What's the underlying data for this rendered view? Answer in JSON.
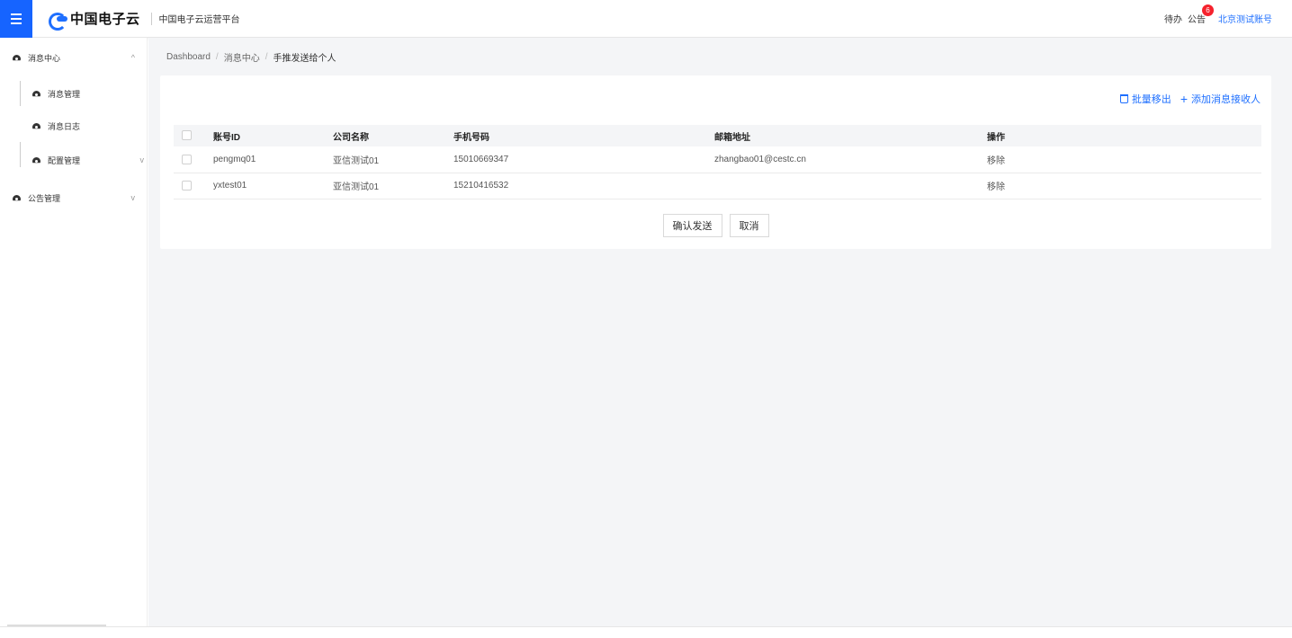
{
  "header": {
    "logo_text": "中国电子云",
    "platform_name": "中国电子云运营平台",
    "todo_label": "待办",
    "notice_label": "公告",
    "notice_badge": "6",
    "account_label": "北京测试账号"
  },
  "sidebar": {
    "items": [
      {
        "label": "消息中心",
        "chevron": "^"
      },
      {
        "label": "消息管理"
      },
      {
        "label": "消息日志"
      },
      {
        "label": "配置管理",
        "chevron": "v"
      },
      {
        "label": "公告管理",
        "chevron": "v"
      }
    ]
  },
  "breadcrumb": {
    "items": [
      "Dashboard",
      "消息中心",
      "手推发送给个人"
    ],
    "separator": "/"
  },
  "actions": {
    "batch_remove_label": "批量移出",
    "add_receiver_label": "添加消息接收人"
  },
  "table": {
    "headers": [
      "账号ID",
      "公司名称",
      "手机号码",
      "邮箱地址",
      "操作"
    ],
    "rows": [
      {
        "account_id": "pengmq01",
        "company": "亚信测试01",
        "phone": "15010669347",
        "email": "zhangbao01@cestc.cn",
        "action": "移除"
      },
      {
        "account_id": "yxtest01",
        "company": "亚信测试01",
        "phone": "15210416532",
        "email": "",
        "action": "移除"
      }
    ]
  },
  "buttons": {
    "confirm_label": "确认发送",
    "cancel_label": "取消"
  },
  "colors": {
    "primary": "#1e6fff",
    "menu_button": "#1664ff",
    "badge": "#f5222d"
  }
}
